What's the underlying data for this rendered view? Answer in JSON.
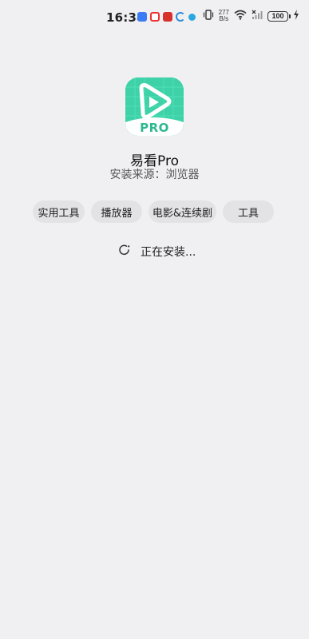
{
  "status_bar": {
    "time": "16:34",
    "net_speed_value": "277",
    "net_speed_unit": "B/s",
    "battery": "100"
  },
  "app": {
    "name": "易看Pro",
    "icon_badge": "PRO",
    "install_source": "安装来源：浏览器",
    "icon_color": "#3fd1a8"
  },
  "tags": [
    "实用工具",
    "播放器",
    "电影&连续剧",
    "工具"
  ],
  "progress": {
    "text": "正在安装..."
  }
}
